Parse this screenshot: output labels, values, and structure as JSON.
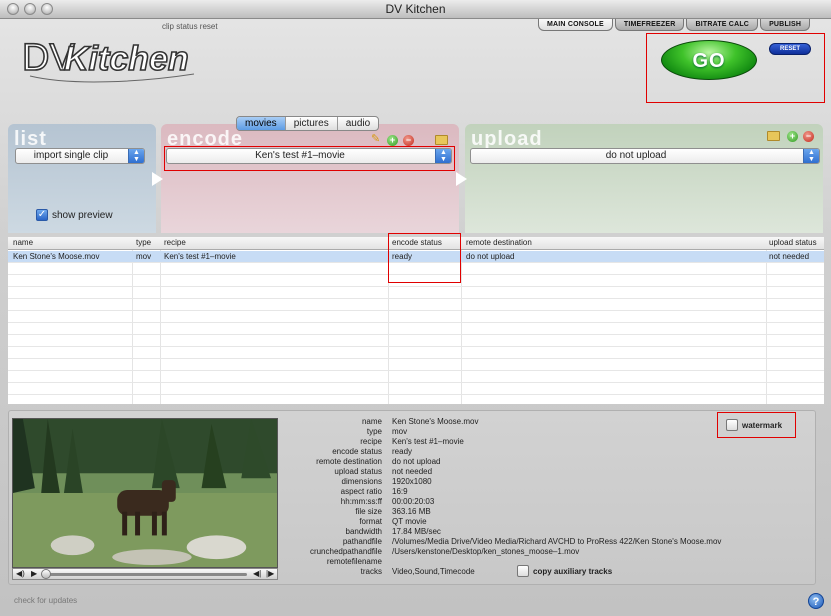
{
  "window": {
    "title": "DV Kitchen"
  },
  "status_message": "clip status reset",
  "tabs": [
    {
      "label": "MAIN CONSOLE",
      "active": true
    },
    {
      "label": "TIMEFREEZER",
      "active": false
    },
    {
      "label": "BITRATE CALC",
      "active": false
    },
    {
      "label": "PUBLISH",
      "active": false
    }
  ],
  "logo": {
    "text_dv": "DV",
    "text_kitchen": "Kitchen"
  },
  "go_button": {
    "label": "GO"
  },
  "reset_button": {
    "label": "RESET"
  },
  "media_tabs": [
    {
      "label": "movies",
      "active": true
    },
    {
      "label": "pictures",
      "active": false
    },
    {
      "label": "audio",
      "active": false
    }
  ],
  "list_panel": {
    "title": "list",
    "select_value": "import single clip",
    "show_preview_label": "show preview",
    "show_preview_checked": true
  },
  "encode_panel": {
    "title": "encode",
    "select_value": "Ken's test #1–movie"
  },
  "upload_panel": {
    "title": "upload",
    "select_value": "do not upload"
  },
  "table": {
    "columns": [
      "name",
      "type",
      "recipe",
      "encode status",
      "remote destination",
      "upload status"
    ],
    "rows": [
      {
        "name": "Ken Stone's Moose.mov",
        "type": "mov",
        "recipe": "Ken's test #1–movie",
        "encode_status": "ready",
        "remote_destination": "do not upload",
        "upload_status": "not needed"
      }
    ]
  },
  "details": [
    {
      "key": "name",
      "value": "Ken Stone's Moose.mov"
    },
    {
      "key": "type",
      "value": "mov"
    },
    {
      "key": "recipe",
      "value": "Ken's test #1–movie"
    },
    {
      "key": "encode status",
      "value": "ready"
    },
    {
      "key": "remote destination",
      "value": "do not upload"
    },
    {
      "key": "upload status",
      "value": "not needed"
    },
    {
      "key": "dimensions",
      "value": "1920x1080"
    },
    {
      "key": "aspect ratio",
      "value": "16:9"
    },
    {
      "key": "hh:mm:ss:ff",
      "value": "00:00:20:03"
    },
    {
      "key": "file size",
      "value": "363.16 MB"
    },
    {
      "key": "format",
      "value": "QT movie"
    },
    {
      "key": "bandwidth",
      "value": "17.84 MB/sec"
    },
    {
      "key": "pathandfile",
      "value": "/Volumes/Media Drive/Video Media/Richard AVCHD to ProRess 422/Ken Stone's Moose.mov"
    },
    {
      "key": "crunchedpathandfile",
      "value": "/Users/kenstone/Desktop/ken_stones_moose–1.mov"
    },
    {
      "key": "remotefilename",
      "value": ""
    },
    {
      "key": "tracks",
      "value": "Video,Sound,Timecode"
    }
  ],
  "watermark": {
    "label": "watermark",
    "checked": false
  },
  "copy_aux": {
    "label": "copy auxiliary tracks",
    "checked": false
  },
  "footer": {
    "check_updates": "check for updates",
    "help": "?"
  }
}
